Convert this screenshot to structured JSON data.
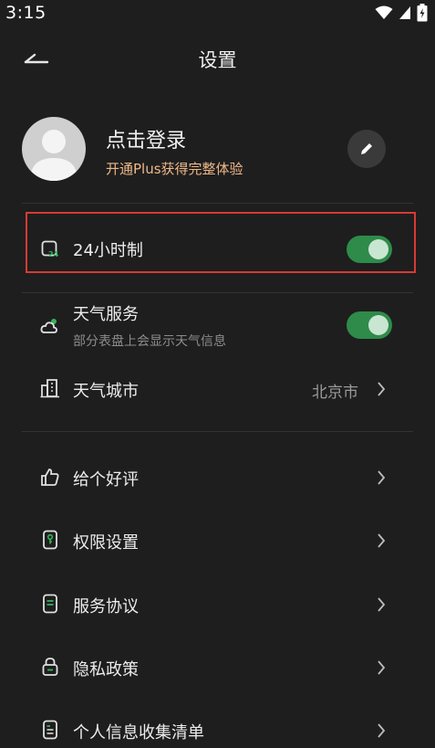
{
  "status_bar": {
    "time": "3:15",
    "icons": [
      "wifi-icon",
      "signal-icon",
      "battery-icon"
    ]
  },
  "header": {
    "title": "设置",
    "back_icon": "back-arrow-icon"
  },
  "profile": {
    "login_label": "点击登录",
    "promo_text": "开通Plus获得完整体验",
    "avatar_icon": "default-avatar-icon",
    "edit_icon": "pencil-icon"
  },
  "settings": {
    "clock_24h": {
      "label": "24小时制",
      "icon": "clock-24-icon",
      "enabled": true
    },
    "weather_service": {
      "label": "天气服务",
      "subtitle": "部分表盘上会显示天气信息",
      "icon": "weather-icon",
      "enabled": true
    },
    "weather_city": {
      "label": "天气城市",
      "value": "北京市",
      "icon": "city-building-icon"
    }
  },
  "menu": [
    {
      "label": "给个好评",
      "icon": "thumbs-up-icon"
    },
    {
      "label": "权限设置",
      "icon": "permission-key-icon"
    },
    {
      "label": "服务协议",
      "icon": "document-icon"
    },
    {
      "label": "隐私政策",
      "icon": "lock-icon"
    },
    {
      "label": "个人信息收集清单",
      "icon": "list-icon"
    }
  ],
  "colors": {
    "background": "#1e1e1e",
    "accent_green": "#2e8b4a",
    "promo_orange": "#efb889",
    "highlight_red": "#d63a34"
  }
}
